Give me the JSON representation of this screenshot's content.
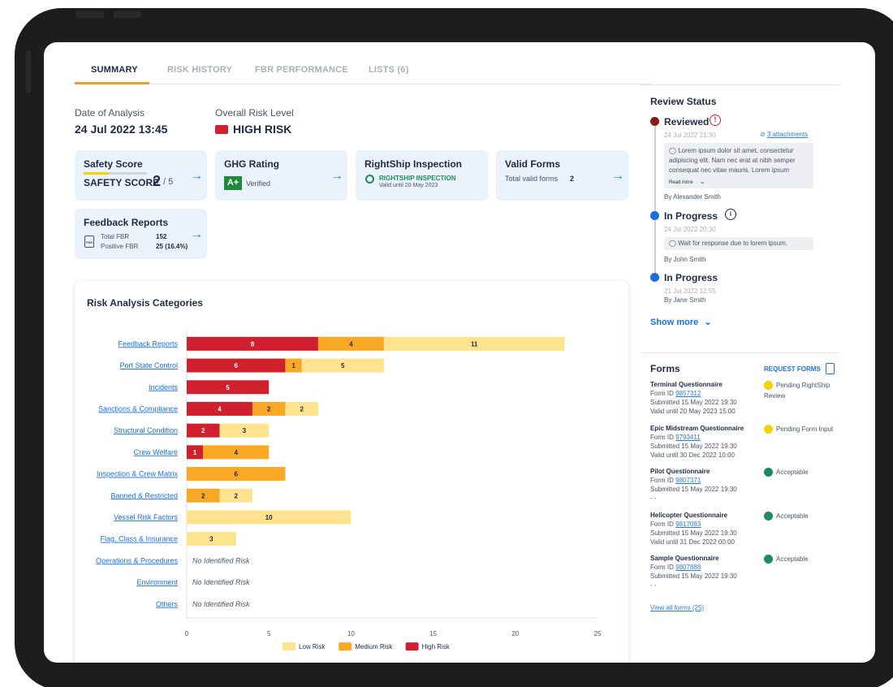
{
  "tabs": [
    {
      "label": "SUMMARY",
      "active": true
    },
    {
      "label": "RISK HISTORY"
    },
    {
      "label": "FBR PERFORMANCE"
    },
    {
      "label": "LISTS (6)"
    }
  ],
  "analysis": {
    "date_label": "Date of Analysis",
    "date_value": "24 Jul 2022 13:45",
    "risk_label": "Overall Risk Level",
    "risk_value": "HIGH RISK",
    "risk_color": "#d0202e"
  },
  "cards": {
    "safety": {
      "title": "Safety Score",
      "label": "SAFETY SCORE",
      "score": "2",
      "total": "/ 5",
      "fill_fraction": 0.4
    },
    "ghg": {
      "title": "GHG Rating",
      "rating": "A+",
      "verified": "Verified"
    },
    "inspection": {
      "title": "RightShip Inspection",
      "badge": "RIGHTSHIP INSPECTION",
      "valid": "Valid until 20 May 2023"
    },
    "valid_forms": {
      "title": "Valid Forms",
      "label": "Total valid forms",
      "count": "2"
    },
    "feedback": {
      "title": "Feedback Reports",
      "total_label": "Total FBR",
      "total_value": "152",
      "positive_label": "Positive FBR",
      "positive_value": "25 (16.4%)",
      "icon_text": "FBR"
    }
  },
  "risk_panel": {
    "title": "Risk Analysis Categories",
    "no_risk_text": "No Identified Risk"
  },
  "colors": {
    "low": "#fde38d",
    "medium": "#f9a825",
    "high": "#d0202e",
    "accent": "#f29a2e",
    "link": "#2b7de0"
  },
  "chart_data": {
    "type": "bar",
    "orientation": "horizontal",
    "stacked": true,
    "title": "Risk Analysis Categories",
    "categories": [
      "Feedback Reports",
      "Port State Control",
      "Incidents",
      "Sanctions & Compliance",
      "Structural Condition",
      "Crew Welfare",
      "Inspection & Crew Matrix",
      "Banned & Restricted",
      "Vessel Risk Factors",
      "Flag, Class & Insurance",
      "Operations & Procedures",
      "Environment",
      "Others"
    ],
    "series": [
      {
        "name": "High Risk",
        "color": "#d0202e",
        "values": [
          8,
          6,
          5,
          4,
          2,
          1,
          0,
          0,
          0,
          0,
          0,
          0,
          0
        ]
      },
      {
        "name": "Medium Risk",
        "color": "#f9a825",
        "values": [
          4,
          1,
          0,
          2,
          0,
          4,
          6,
          2,
          0,
          0,
          0,
          0,
          0
        ]
      },
      {
        "name": "Low Risk",
        "color": "#fde38d",
        "values": [
          11,
          5,
          0,
          2,
          3,
          0,
          0,
          2,
          10,
          3,
          0,
          0,
          0
        ]
      }
    ],
    "xlim": [
      0,
      25
    ],
    "xticks": [
      0,
      5,
      10,
      15,
      20,
      25
    ],
    "legend": [
      "Low Risk",
      "Medium Risk",
      "High Risk"
    ],
    "legend_position": "bottom",
    "grid": false
  },
  "review": {
    "title": "Review Status",
    "entries": [
      {
        "status": "Reviewed",
        "time": "24 Jul 2022 21:30",
        "attachments": "3 attachments",
        "comment": "Lorem ipsum dolor sit amet, consectetur adipiscing elit. Nam nec erat at nibh semper consequat nec vitae mauris. Lorem ipsum",
        "read_more": "Read more",
        "by": "By Alexander Smith",
        "color": "#8b1a1a",
        "icon": "alert-icon"
      },
      {
        "status": "In Progress",
        "time": "24 Jul 2022 20:30",
        "comment": "Wait for response due to lorem ipsum.",
        "by": "By John Smith",
        "color": "#1a6fe0",
        "icon": "info-icon"
      },
      {
        "status": "In Progress",
        "time": "21 Jul 2022 12:55",
        "by": "By Jane Smith",
        "color": "#1a6fe0"
      }
    ],
    "show_more": "Show more"
  },
  "forms": {
    "title": "Forms",
    "request": "REQUEST FORMS",
    "items": [
      {
        "name": "Terminal Questionnaire",
        "id_label": "Form ID",
        "id": "9857312",
        "submitted": "Submitted 15 May 2022 19:30",
        "valid": "Valid until 20 May 2023 15:00",
        "status": "Pending RightShip Review",
        "status_color": "#f5d300"
      },
      {
        "name": "Epic Midstream Questionnaire",
        "id_label": "Form ID",
        "id": "9793411",
        "submitted": "Submitted 15 May 2022 19:30",
        "valid": "Valid until 30 Dec 2022 10:00",
        "status": "Pending Form Input",
        "status_color": "#f5d300"
      },
      {
        "name": "Pilot Questionnaire",
        "id_label": "Form ID",
        "id": "9807371",
        "submitted": "Submitted 15 May 2022 19:30",
        "valid": "- -",
        "status": "Acceptable",
        "status_color": "#1f8a5b"
      },
      {
        "name": "Helicopter Questionnaire",
        "id_label": "Form ID",
        "id": "9817083",
        "submitted": "Submitted 15 May 2022 19:30",
        "valid": "Valid until 31 Dec 2022 00:00",
        "status": "Acceptable",
        "status_color": "#1f8a5b"
      },
      {
        "name": "Sample Questionnaire",
        "id_label": "Form ID",
        "id": "9807888",
        "submitted": "Submitted 15 May 2022 19:30",
        "valid": "- -",
        "status": "Acceptable",
        "status_color": "#1f8a5b"
      }
    ],
    "view_all": "View all forms (25)"
  }
}
